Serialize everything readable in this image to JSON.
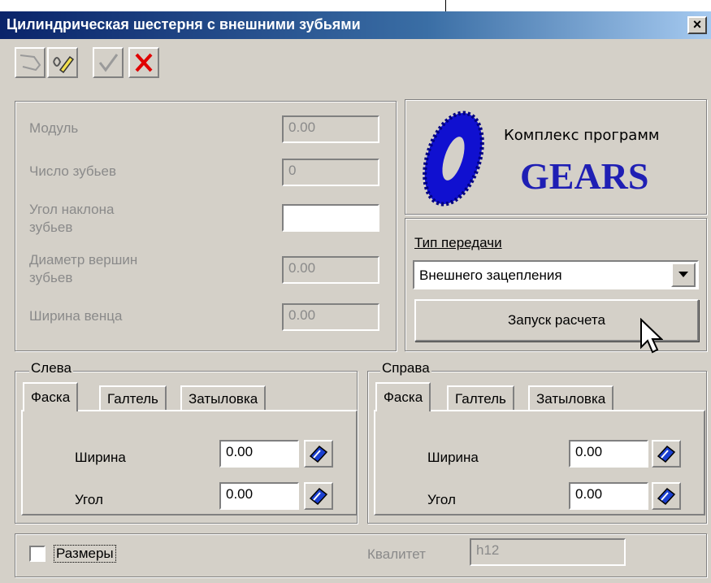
{
  "window": {
    "title": "Цилиндрическая шестерня с внешними зубьями",
    "close": "×"
  },
  "toolbar": {
    "icons": [
      "select-icon",
      "edit-icon",
      "check-icon",
      "delete-icon"
    ]
  },
  "params": {
    "module": {
      "label": "Модуль",
      "value": "0.00"
    },
    "teeth": {
      "label": "Число зубьев",
      "value": "0"
    },
    "helix": {
      "label_line1": "Угол наклона",
      "label_line2": "зубьев",
      "value": ""
    },
    "tip_diam": {
      "label_line1": "Диаметр вершин",
      "label_line2": "зубьев",
      "value": "0.00"
    },
    "face_width": {
      "label": "Ширина венца",
      "value": "0.00"
    }
  },
  "logo": {
    "caption": "Комплекс программ",
    "brand": "GEARS"
  },
  "gear_type": {
    "label": "Тип передачи",
    "selected": "Внешнего зацепления",
    "run_button": "Запуск расчета"
  },
  "left": {
    "title": "Слева",
    "tabs": [
      "Фаска",
      "Галтель",
      "Затыловка"
    ],
    "width": {
      "label": "Ширина",
      "value": "0.00"
    },
    "angle": {
      "label": "Угол",
      "value": "0.00"
    }
  },
  "right": {
    "title": "Справа",
    "tabs": [
      "Фаска",
      "Галтель",
      "Затыловка"
    ],
    "width": {
      "label": "Ширина",
      "value": "0.00"
    },
    "angle": {
      "label": "Угол",
      "value": "0.00"
    }
  },
  "footer": {
    "dimensions_label": "Размеры",
    "quality_label": "Квалитет",
    "quality_value": "h12"
  },
  "colors": {
    "face": "#d4d0c8",
    "title_start": "#0a246a",
    "title_end": "#a6caf0",
    "brand": "#1f1fb4",
    "delete": "#e00000"
  }
}
